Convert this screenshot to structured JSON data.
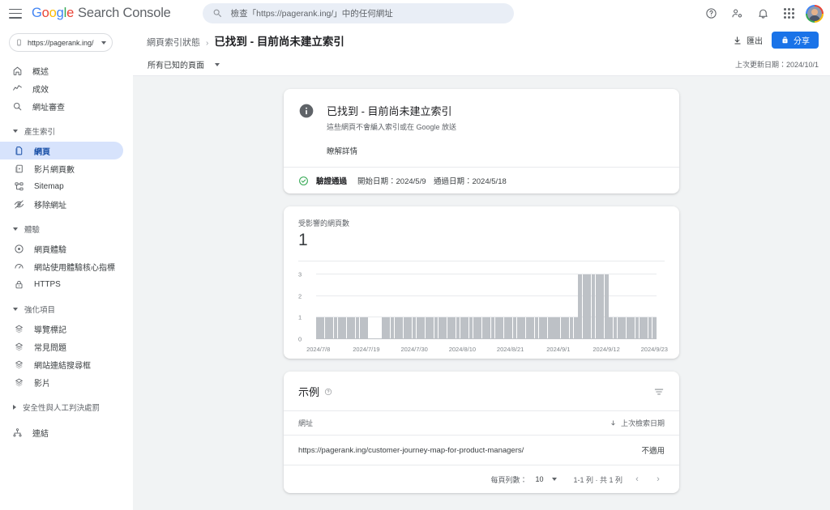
{
  "app": {
    "brand_google": [
      "G",
      "o",
      "o",
      "g",
      "l",
      "e"
    ],
    "brand_product": "Search Console"
  },
  "search": {
    "placeholder": "檢查「https://pagerank.ing/」中的任何網址"
  },
  "topbar": {
    "icons": [
      "help-icon",
      "user-settings-icon",
      "notifications-icon",
      "apps-grid-icon",
      "avatar"
    ]
  },
  "sidebar": {
    "property": "https://pagerank.ing/",
    "items": [
      {
        "label": "概述",
        "icon": "home-icon",
        "type": "item",
        "active": false
      },
      {
        "label": "成效",
        "icon": "performance-icon",
        "type": "item",
        "active": false
      },
      {
        "label": "網址審查",
        "icon": "search-icon",
        "type": "item",
        "active": false
      },
      {
        "label": "產生索引",
        "icon": "caret-down-icon",
        "type": "group",
        "expanded": true
      },
      {
        "label": "網頁",
        "icon": "pages-icon",
        "type": "item",
        "active": true
      },
      {
        "label": "影片網頁數",
        "icon": "video-pages-icon",
        "type": "item",
        "active": false
      },
      {
        "label": "Sitemap",
        "icon": "sitemap-icon",
        "type": "item",
        "active": false
      },
      {
        "label": "移除網址",
        "icon": "remove-url-icon",
        "type": "item",
        "active": false
      },
      {
        "label": "體驗",
        "icon": "caret-down-icon",
        "type": "group",
        "expanded": true
      },
      {
        "label": "網頁體驗",
        "icon": "page-experience-icon",
        "type": "item",
        "active": false
      },
      {
        "label": "網站使用體驗核心指標",
        "icon": "core-web-vitals-icon",
        "type": "item",
        "active": false
      },
      {
        "label": "HTTPS",
        "icon": "lock-icon",
        "type": "item",
        "active": false
      },
      {
        "label": "強化項目",
        "icon": "caret-down-icon",
        "type": "group",
        "expanded": true
      },
      {
        "label": "導覽標記",
        "icon": "breadcrumb-icon",
        "type": "item",
        "active": false
      },
      {
        "label": "常見問題",
        "icon": "faq-icon",
        "type": "item",
        "active": false
      },
      {
        "label": "網站連結搜尋框",
        "icon": "sitelinks-searchbox-icon",
        "type": "item",
        "active": false
      },
      {
        "label": "影片",
        "icon": "video-icon",
        "type": "item",
        "active": false
      },
      {
        "label": "安全性與人工判決處罰",
        "icon": "caret-right-icon",
        "type": "group",
        "expanded": false
      },
      {
        "label": "連結",
        "icon": "links-icon",
        "type": "item",
        "active": false
      }
    ]
  },
  "header": {
    "breadcrumb_parent": "網頁索引狀態",
    "breadcrumb_separator": "›",
    "breadcrumb_current": "已找到 - 目前尚未建立索引",
    "export_label": "匯出",
    "share_label": "分享"
  },
  "subbar": {
    "filter_label": "所有已知的頁面",
    "last_update": "上次更新日期：2024/10/1"
  },
  "status_card": {
    "title": "已找到 - 目前尚未建立索引",
    "subtitle": "這些網頁不會編入索引或在 Google 放送",
    "learn_more": "瞭解詳情",
    "validation_label": "驗證通過",
    "validation_dates": "開始日期：2024/5/9　通過日期：2024/5/18",
    "accent_color": "#34A853",
    "info_color": "#5f6368"
  },
  "chart_card": {
    "metric_label": "受影響的網頁數",
    "metric_value": "1"
  },
  "chart_data": {
    "type": "bar",
    "title": "受影響的網頁數",
    "xlabel": "",
    "ylabel": "",
    "ylim": [
      0,
      3
    ],
    "yticks": [
      0,
      1,
      2,
      3
    ],
    "grid": true,
    "legend": "none",
    "bar_color": "#bdc1c6",
    "tick_labels": [
      "2024/7/8",
      "2024/7/19",
      "2024/7/30",
      "2024/8/10",
      "2024/8/21",
      "2024/9/1",
      "2024/9/12",
      "2024/9/23"
    ],
    "tick_positions": [
      0,
      11,
      22,
      33,
      44,
      55,
      66,
      77
    ],
    "x_start": "2024/7/8",
    "x_end": "2024/9/29",
    "values": [
      1,
      1,
      1,
      1,
      1,
      1,
      1,
      1,
      1,
      1,
      1,
      1,
      0,
      0,
      0,
      1,
      1,
      1,
      1,
      1,
      1,
      1,
      1,
      1,
      1,
      1,
      1,
      1,
      1,
      1,
      1,
      1,
      1,
      1,
      1,
      1,
      1,
      1,
      1,
      1,
      1,
      1,
      1,
      1,
      1,
      1,
      1,
      1,
      1,
      1,
      1,
      1,
      1,
      1,
      1,
      1,
      1,
      1,
      1,
      1,
      3,
      3,
      3,
      3,
      3,
      3,
      3,
      1,
      1,
      1,
      1,
      1,
      1,
      1,
      1,
      1,
      1,
      1
    ]
  },
  "examples_card": {
    "title": "示例",
    "help_icon": "help-icon",
    "filter_icon": "filter-icon",
    "columns": [
      "網址",
      "上次檢索日期"
    ],
    "sort_column": "上次檢索日期",
    "sort_direction": "desc",
    "rows": [
      {
        "url": "https://pagerank.ing/customer-journey-map-for-product-managers/",
        "last_crawl": "不適用"
      }
    ],
    "rows_per_page_label": "每頁列數：",
    "rows_per_page_value": "10",
    "range_label": "1-1 列 · 共 1 列",
    "prev_label": "‹",
    "next_label": "›"
  }
}
